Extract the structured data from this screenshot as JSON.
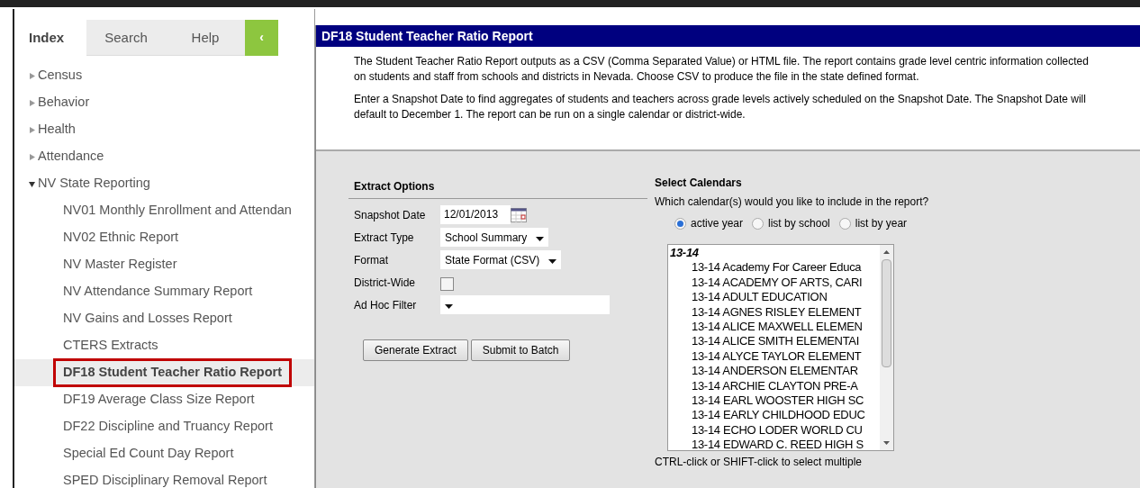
{
  "sidebar": {
    "tabs": [
      {
        "label": "Index",
        "selected": true
      },
      {
        "label": "Search",
        "selected": false
      },
      {
        "label": "Help",
        "selected": false
      }
    ],
    "collapse_button": "‹",
    "items": [
      {
        "label": "Census",
        "expanded": false,
        "selected": false
      },
      {
        "label": "Behavior",
        "expanded": false,
        "selected": false
      },
      {
        "label": "Health",
        "expanded": false,
        "selected": false
      },
      {
        "label": "Attendance",
        "expanded": false,
        "selected": false
      },
      {
        "label": "NV State Reporting",
        "expanded": true,
        "selected": false,
        "children": [
          {
            "label": "NV01 Monthly Enrollment and Attendan",
            "selected": false
          },
          {
            "label": "NV02 Ethnic Report",
            "selected": false
          },
          {
            "label": "NV Master Register",
            "selected": false
          },
          {
            "label": "NV Attendance Summary Report",
            "selected": false
          },
          {
            "label": "NV Gains and Losses Report",
            "selected": false
          },
          {
            "label": "CTERS Extracts",
            "selected": false
          },
          {
            "label": "DF18 Student Teacher Ratio Report",
            "selected": true
          },
          {
            "label": "DF19 Average Class Size Report",
            "selected": false
          },
          {
            "label": "DF22 Discipline and Truancy Report",
            "selected": false
          },
          {
            "label": "Special Ed Count Day Report",
            "selected": false
          },
          {
            "label": "SPED Disciplinary Removal Report",
            "selected": false
          }
        ]
      }
    ]
  },
  "report": {
    "title": "DF18 Student Teacher Ratio Report",
    "paragraphs": [
      "The Student Teacher Ratio Report outputs as a CSV (Comma Separated Value) or HTML file. The report contains grade level centric information collected on students and staff from schools and districts in Nevada. Choose CSV to produce the file in the state defined format.",
      "Enter a Snapshot Date to find aggregates of students and teachers across grade levels actively scheduled on the Snapshot Date. The Snapshot Date will default to December 1. The report can be run on a single calendar or district-wide."
    ]
  },
  "extract_options": {
    "heading": "Extract Options",
    "fields": [
      {
        "kind": "date",
        "label": "Snapshot Date",
        "value": "12/01/2013"
      },
      {
        "kind": "select",
        "label": "Extract Type",
        "value": "School Summary"
      },
      {
        "kind": "select",
        "label": "Format",
        "value": "State Format (CSV)"
      },
      {
        "kind": "checkbox",
        "label": "District-Wide",
        "checked": false
      },
      {
        "kind": "select",
        "label": "Ad Hoc Filter"
      }
    ],
    "buttons": [
      "Generate Extract",
      "Submit to Batch"
    ]
  },
  "calendars": {
    "heading": "Select Calendars",
    "question": "Which calendar(s) would you like to include in the report?",
    "options": [
      {
        "label": "active year",
        "selected": true
      },
      {
        "label": "list by school",
        "selected": false
      },
      {
        "label": "list by year",
        "selected": false
      }
    ],
    "group": "13-14",
    "items": [
      "13-14 Academy For Career Educa",
      "13-14 ACADEMY OF ARTS, CARI",
      "13-14 ADULT EDUCATION",
      "13-14 AGNES RISLEY ELEMENT",
      "13-14 ALICE MAXWELL ELEMEN",
      "13-14 ALICE SMITH ELEMENTAI",
      "13-14 ALYCE TAYLOR ELEMENT",
      "13-14 ANDERSON ELEMENTAR",
      "13-14 ARCHIE CLAYTON PRE-A",
      "13-14 EARL WOOSTER HIGH SC",
      "13-14 EARLY CHILDHOOD EDUC",
      "13-14 ECHO LODER WORLD CU",
      "13-14 EDWARD C. REED HIGH S"
    ],
    "hint": "CTRL-click or SHIFT-click to select multiple"
  }
}
